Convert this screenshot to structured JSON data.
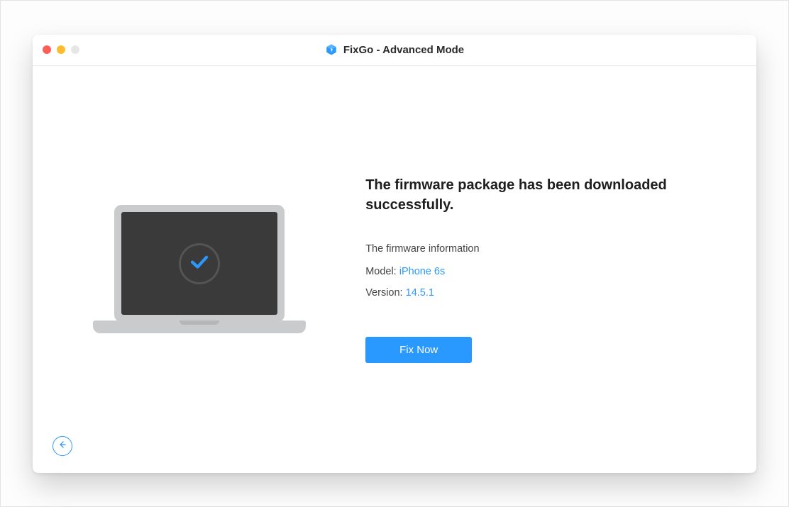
{
  "window": {
    "title": "FixGo - Advanced Mode"
  },
  "main": {
    "headline": "The firmware package has been downloaded successfully.",
    "subheading": "The firmware information",
    "model_label": "Model:",
    "model_value": "iPhone 6s",
    "version_label": "Version:",
    "version_value": "14.5.1",
    "fix_button": "Fix Now"
  },
  "icons": {
    "app_logo": "fixgo-cube-icon",
    "laptop_check": "checkmark-icon",
    "back_arrow": "arrow-left-icon"
  },
  "colors": {
    "accent": "#2a99ff",
    "screen_bg": "#3a3a3a",
    "device_body": "#c9cbcd"
  }
}
